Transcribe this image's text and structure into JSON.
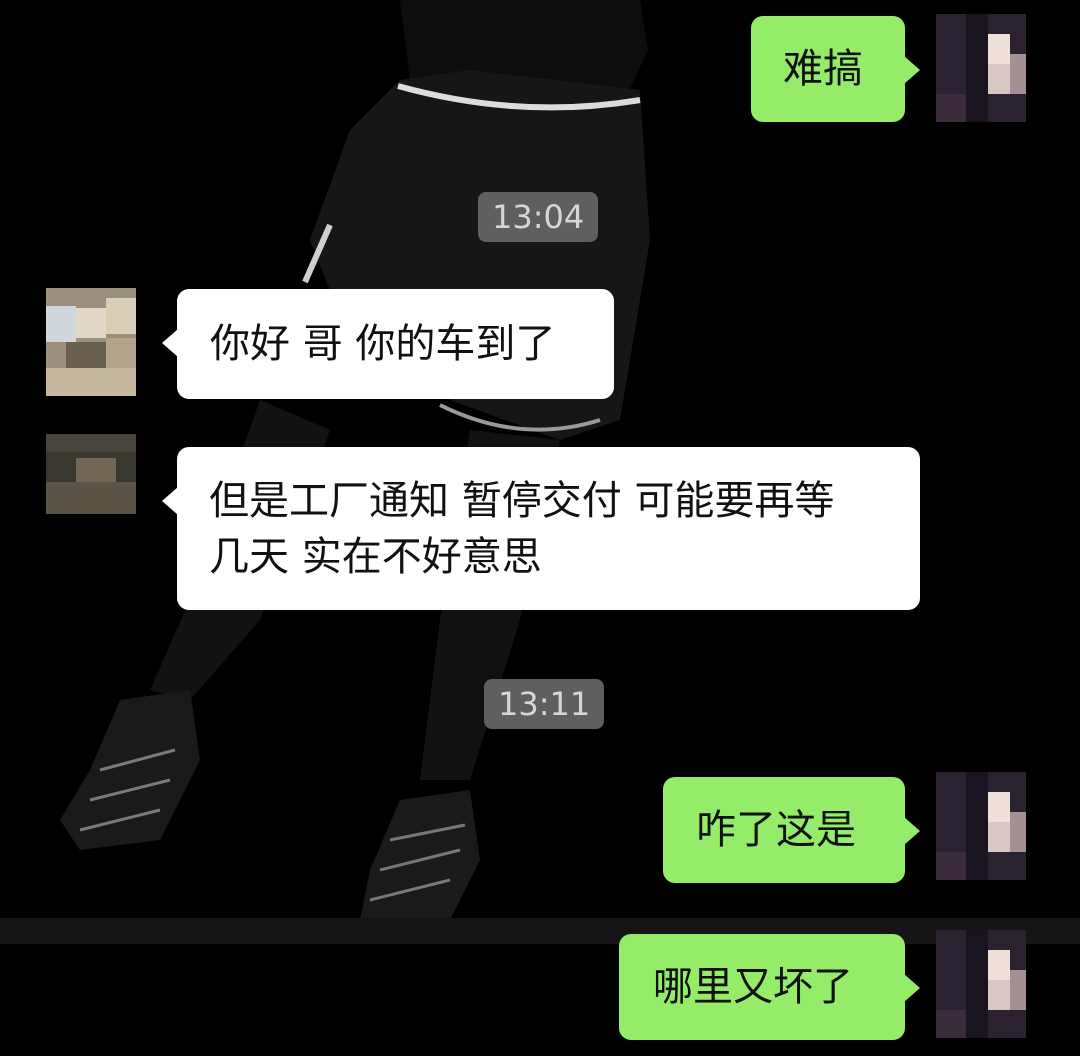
{
  "chat": {
    "messages": [
      {
        "side": "right",
        "text": "难搞"
      },
      {
        "side": "left",
        "text": "你好 哥 你的车到了"
      },
      {
        "side": "left",
        "text": "但是工厂通知 暂停交付 可能要再等\n几天 实在不好意思"
      },
      {
        "side": "right",
        "text": "咋了这是"
      },
      {
        "side": "right",
        "text": "哪里又坏了"
      }
    ],
    "timestamps": [
      "13:04",
      "13:11"
    ]
  },
  "colors": {
    "background": "#000000",
    "incoming_bubble": "#ffffff",
    "outgoing_bubble": "#95ec69",
    "timestamp_pill": "#5f5f5f"
  }
}
